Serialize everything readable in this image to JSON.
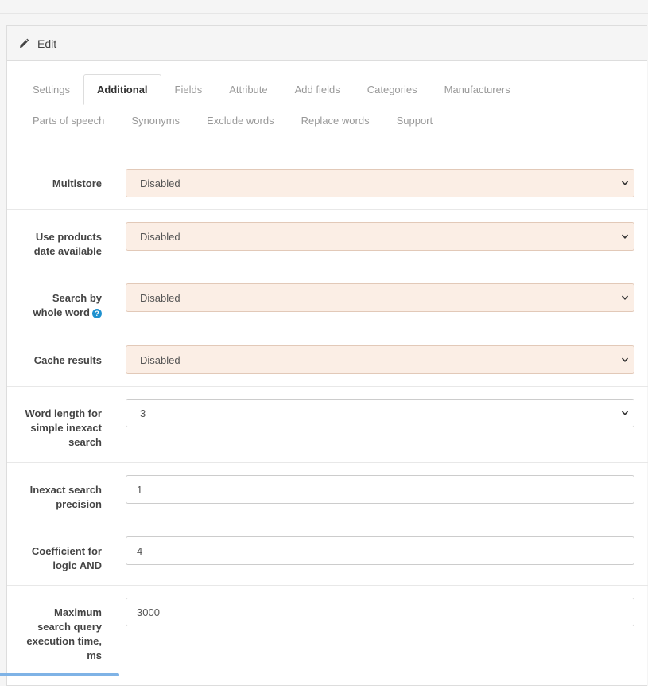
{
  "panel": {
    "title": "Edit"
  },
  "tabs": {
    "row1": [
      "Settings",
      "Additional",
      "Fields",
      "Attribute",
      "Add fields",
      "Categories",
      "Manufacturers"
    ],
    "row2": [
      "Parts of speech",
      "Synonyms",
      "Exclude words",
      "Replace words",
      "Support"
    ],
    "active": "Additional"
  },
  "form": {
    "multistore": {
      "label": "Multistore",
      "value": "Disabled"
    },
    "use_products_date": {
      "label_line1": "Use products",
      "label_line2": "date available",
      "value": "Disabled"
    },
    "search_whole_word": {
      "label_line1": "Search by",
      "label_line2": "whole word",
      "help": "?",
      "value": "Disabled"
    },
    "cache_results": {
      "label": "Cache results",
      "value": "Disabled"
    },
    "word_length": {
      "label_line1": "Word length for",
      "label_line2": "simple inexact",
      "label_line3": "search",
      "value": "3"
    },
    "inexact_precision": {
      "label_line1": "Inexact search",
      "label_line2": "precision",
      "value": "1"
    },
    "coef_and": {
      "label_line1": "Coefficient for",
      "label_line2": "logic AND",
      "value": "4"
    },
    "max_time": {
      "label_line1": "Maximum",
      "label_line2": "search query",
      "label_line3": "execution time,",
      "label_line4": "ms",
      "value": "3000"
    }
  },
  "colors": {
    "accent": "#1e91cf",
    "warning_bg": "#fbeee5"
  },
  "icons": {
    "heading": "pencil-icon",
    "select": "chevron-down-icon",
    "help": "question-circle-icon"
  }
}
